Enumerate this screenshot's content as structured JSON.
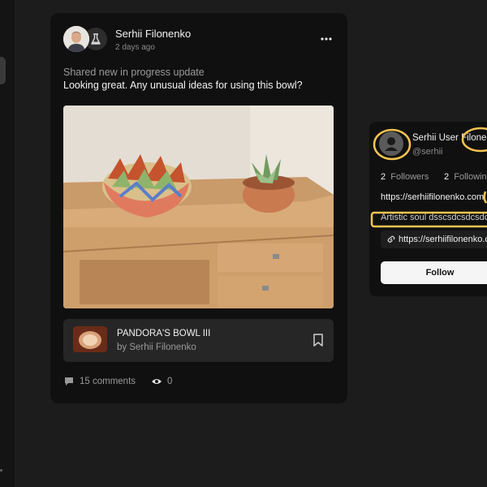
{
  "post": {
    "author": "Serhii Filonenko",
    "time": "2 days ago",
    "shared_label": "Shared new in progress update",
    "text": "Looking great. Any unusual ideas for using this bowl?",
    "project": {
      "title": "PANDORA'S BOWL III",
      "author": "by Serhii Filonenko"
    },
    "comments": "15 comments",
    "views": "0"
  },
  "profile": {
    "name": "Serhii User Filonenko",
    "handle": "@serhii",
    "followers_count": "2",
    "followers_label": "Followers",
    "following_count": "2",
    "following_label": "Following",
    "website": "https://serhiifilonenko.com",
    "bio": "Artistic soul dsscsdcsdcsdcs",
    "link": "https://serhiifilonenko.com",
    "follow_label": "Follow"
  },
  "colors": {
    "annotation": "#f5c451",
    "background": "#1c1c1c",
    "card": "#101010"
  },
  "icons": [
    "flask-icon",
    "more-icon",
    "bookmark-icon",
    "comment-icon",
    "eye-icon",
    "user-icon",
    "link-icon"
  ]
}
